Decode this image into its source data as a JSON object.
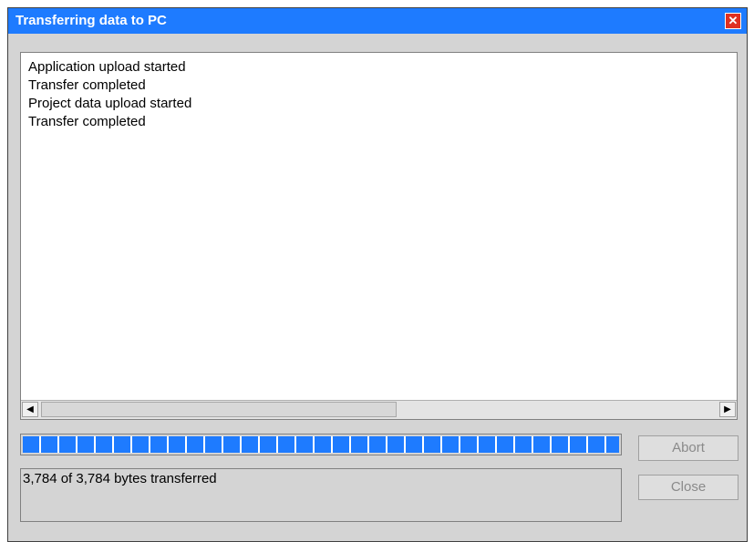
{
  "window": {
    "title": "Transferring data to PC"
  },
  "log": {
    "lines": [
      "Application upload started",
      "Transfer completed",
      "Project data upload started",
      "Transfer completed"
    ]
  },
  "progress": {
    "fraction": 1.0
  },
  "status": {
    "text": "3,784 of 3,784 bytes transferred"
  },
  "buttons": {
    "abort": "Abort",
    "close": "Close"
  },
  "icons": {
    "close": "close-icon",
    "scroll_left": "arrow-left-icon",
    "scroll_right": "arrow-right-icon"
  },
  "colors": {
    "titlebar": "#1e7bff",
    "progress": "#1e7bff",
    "close_button": "#e03020"
  }
}
